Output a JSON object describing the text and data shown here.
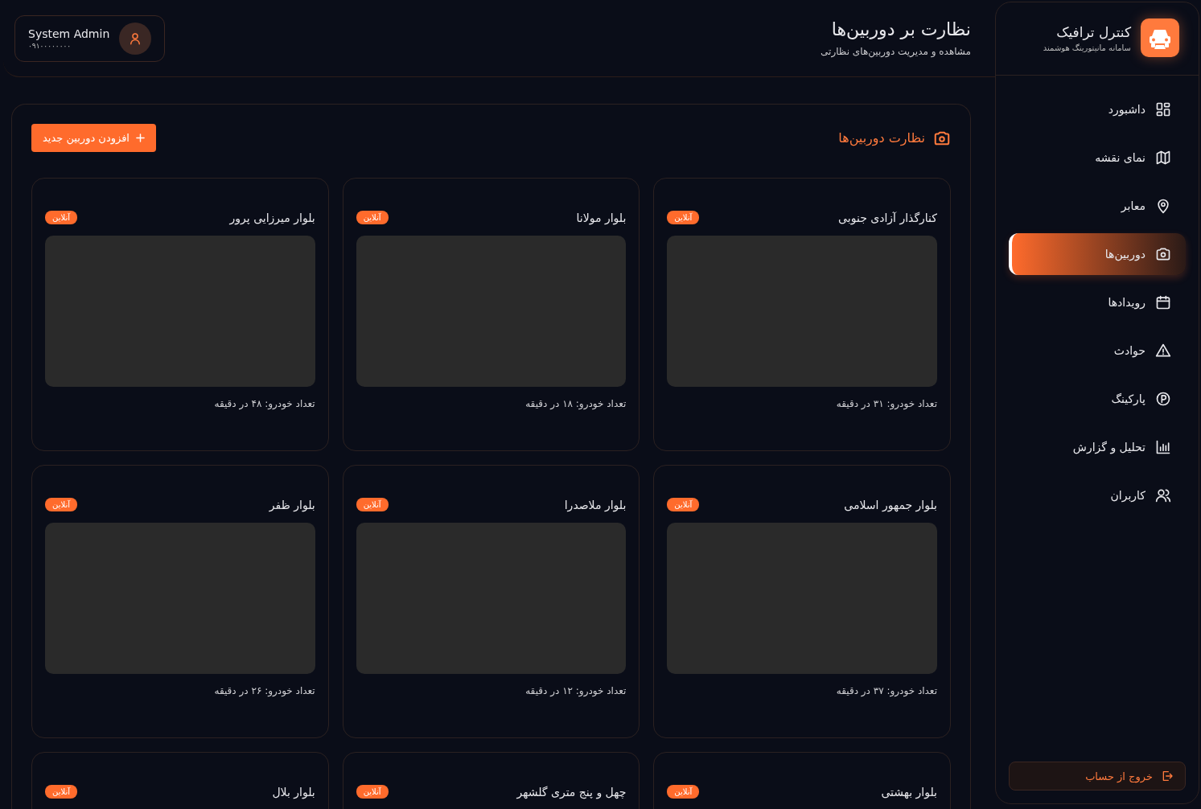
{
  "sidebar": {
    "brand": {
      "title": "کنترل ترافیک",
      "subtitle": "سامانه مانیتورینگ هوشمند"
    },
    "items": [
      {
        "label": "داشبورد",
        "kind": "grid",
        "selected": false
      },
      {
        "label": "نمای نقشه",
        "kind": "map",
        "selected": false
      },
      {
        "label": "معابر",
        "kind": "pin",
        "selected": false
      },
      {
        "label": "دوربین‌ها",
        "kind": "camera",
        "selected": true
      },
      {
        "label": "رویدادها",
        "kind": "calendar",
        "selected": false
      },
      {
        "label": "حوادث",
        "kind": "warning",
        "selected": false
      },
      {
        "label": "پارکینگ",
        "kind": "parking",
        "selected": false
      },
      {
        "label": "تحلیل و گزارش",
        "kind": "chart",
        "selected": false
      },
      {
        "label": "کاربران",
        "kind": "users",
        "selected": false
      }
    ],
    "logout": "خروج از حساب"
  },
  "header": {
    "title": "نظارت بر دوربین‌ها",
    "subtitle": "مشاهده و مدیریت دوربین‌های نظارتی",
    "user": {
      "name": "System Admin",
      "phone": "۰۹۱۰۰۰۰۰۰۰۰"
    }
  },
  "panel": {
    "title": "نظارت دوربین‌ها",
    "add_button": "افزودن دوربین جدید",
    "cameras": [
      {
        "name": "کنارگذار آزادی جنوبی",
        "status": "آنلاین",
        "online": true,
        "count": "تعداد خودرو: ۳۱ در دقیقه"
      },
      {
        "name": "بلوار مولانا",
        "status": "آنلاین",
        "online": true,
        "count": "تعداد خودرو: ۱۸ در دقیقه"
      },
      {
        "name": "بلوار میرزایی پرور",
        "status": "آنلاین",
        "online": true,
        "count": "تعداد خودرو: ۴۸ در دقیقه"
      },
      {
        "name": "بلوار جمهور اسلامی",
        "status": "آنلاین",
        "online": true,
        "count": "تعداد خودرو: ۳۷ در دقیقه"
      },
      {
        "name": "بلوار ملاصدرا",
        "status": "آنلاین",
        "online": true,
        "count": "تعداد خودرو: ۱۲ در دقیقه"
      },
      {
        "name": "بلوار ظفر",
        "status": "آنلاین",
        "online": true,
        "count": "تعداد خودرو: ۲۶ در دقیقه"
      },
      {
        "name": "بلوار بهشتی",
        "status": "آنلاین",
        "online": true
      },
      {
        "name": "چهل و پنج متری گلشهر",
        "status": "آنلاین",
        "online": true
      },
      {
        "name": "بلوار بلال",
        "status": "آنلاین",
        "online": true
      }
    ]
  }
}
